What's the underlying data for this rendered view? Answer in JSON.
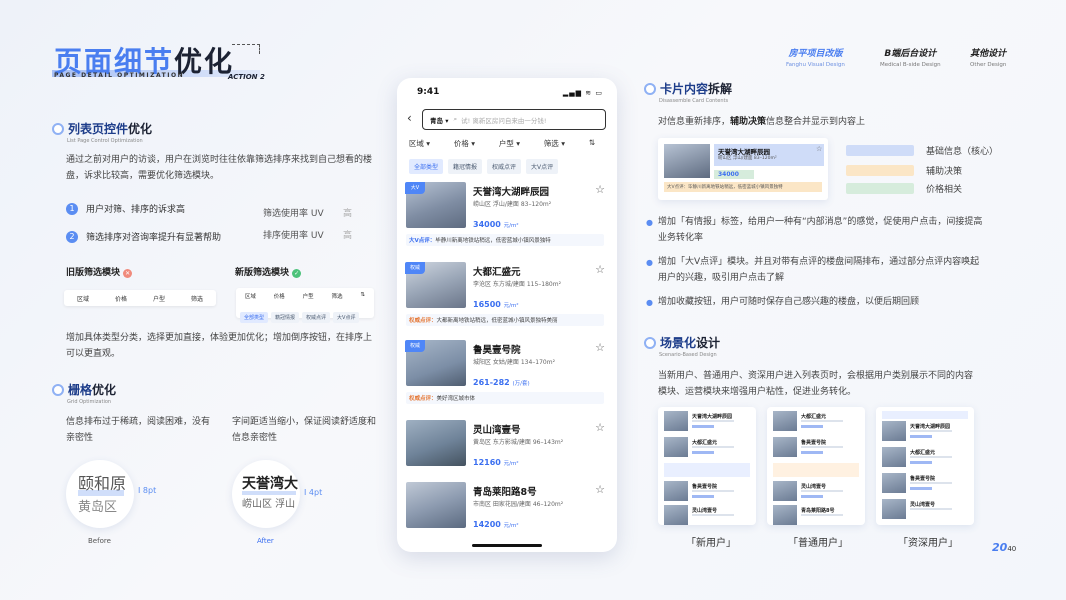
{
  "header": {
    "title_a": "页面细节",
    "title_b": "优化",
    "subtitle": "PAGE DETAIL OPTIMIZATION",
    "action": "ACTION 2",
    "nav": [
      {
        "cn": "房平项目改版",
        "en": "Fanghu Visual Design",
        "active": true
      },
      {
        "cn": "B端后台设计",
        "en": "Medical B-side Design",
        "active": false
      },
      {
        "cn": "其他设计",
        "en": "Other Design",
        "active": false
      }
    ]
  },
  "left": {
    "sec1": {
      "title_a": "列表页控件",
      "title_b": "优化",
      "sub": "List Page Control Optimization",
      "para": "通过之前对用户的访谈，用户在浏览时往往依靠筛选排序来找到自己想看的楼盘，诉求比较高，需要优化筛选模块。",
      "items": [
        {
          "n": "1",
          "text": "用户对筛、排序的诉求高",
          "metric": "筛选使用率 UV",
          "level": "高"
        },
        {
          "n": "2",
          "text": "筛选排序对咨询率提升有显著帮助",
          "metric": "排序使用率 UV",
          "level": "高"
        }
      ],
      "old_label": "旧版筛选模块",
      "new_label": "新版筛选模块",
      "filters": [
        "区域",
        "价格",
        "户型",
        "筛选"
      ],
      "chips": [
        "全部类型",
        "籍冠情报",
        "权威点评",
        "大V点评"
      ],
      "para2": "增加具体类型分类，选择更加直接，体验更加优化；增加倒序按钮，在排序上可以更直观。"
    },
    "sec2": {
      "title_a": "栅格",
      "title_b": "优化",
      "sub": "Grid Optimization",
      "before_text": "信息排布过于稀疏，阅读困难，没有亲密性",
      "after_text": "字间距适当缩小，保证阅读舒适度和信息亲密性",
      "before_name": "颐和原",
      "before_area": "黄岛区",
      "before_gap": "8pt",
      "before_label": "Before",
      "after_name": "天誉湾大",
      "after_area": "崂山区 浮山",
      "after_gap": "4pt",
      "after_label": "After"
    }
  },
  "phone": {
    "time": "9:41",
    "status": "▂▄▆ ≋ ▭",
    "city": "青岛 ▾",
    "placeholder": "试! 离新区房问自来由一分钱!",
    "back": "‹",
    "filters": [
      "区域 ▾",
      "价格 ▾",
      "户型 ▾",
      "筛选 ▾",
      "⇅"
    ],
    "chips": [
      "全部类型",
      "籍冠情报",
      "权威点评",
      "大V点评"
    ],
    "cards": [
      {
        "badge": "大V",
        "name": "天誉湾大湖畔辰园",
        "addr": "崂山区 浮山/建面 83–120m²",
        "price": "34000",
        "unit": "元/m²",
        "cmt_tag": "大V点评：",
        "cmt": "毕静川新离地铁站稍远，低密蓝城小镇风景独特",
        "cmt_type": "v"
      },
      {
        "badge": "权威",
        "name": "大都汇盛元",
        "addr": "李沧区 东方城/建面 115–180m²",
        "price": "16500",
        "unit": "元/m²",
        "cmt_tag": "权威点评：",
        "cmt": "大都新离地铁站稍远，低密蓝城小镇风景独特美丽",
        "cmt_type": "o"
      },
      {
        "badge": "权威",
        "name": "鲁昊壹号院",
        "addr": "城阳区 女姑/建面 134–170m²",
        "price": "261-282",
        "unit": "(万/套)",
        "cmt_tag": "权威点评：",
        "cmt": "美好湾区城市体",
        "cmt_type": "o"
      },
      {
        "badge": "",
        "name": "灵山湾壹号",
        "addr": "黄岛区 东方影城/建面 96–143m²",
        "price": "12160",
        "unit": "元/m²",
        "cmt_tag": "",
        "cmt": "",
        "cmt_type": ""
      },
      {
        "badge": "",
        "name": "青岛莱阳路8号",
        "addr": "市南区 田家花园/建面 46–120m²",
        "price": "14200",
        "unit": "元/m²",
        "cmt_tag": "",
        "cmt": "",
        "cmt_type": ""
      }
    ]
  },
  "right": {
    "sec3": {
      "title_a": "卡片内容",
      "title_b": "拆解",
      "sub": "Disassemble Card Contents",
      "intro_a": "对信息重新排序，",
      "intro_b": "辅助决策",
      "intro_c": "信息整合并显示到内容上",
      "legend": [
        {
          "text": "基础信息（核心）",
          "color": "#cfdcf8"
        },
        {
          "text": "辅助决策",
          "color": "#fbe6c6"
        },
        {
          "text": "价格相关",
          "color": "#d6ecdc"
        }
      ],
      "card_name": "天誉湾大湖畔辰园",
      "card_addr": "崂山区 浮山/建面 83–120m²",
      "card_price": "34000",
      "card_cmt": "大V点评：毕静川新离地铁站稍远，低密蓝城小镇风景独特",
      "bullets": [
        "增加「有情报」标签，给用户一种有“内部消息”的感觉，促使用户点击，间接提高业务转化率",
        "增加「大V点评」模块。并且对带有点评的楼盘间隔排布，通过部分点评内容唤起用户的兴趣，吸引用户点击了解",
        "增加收藏按钮，用户可随时保存自己感兴趣的楼盘，以便后期回顾"
      ]
    },
    "sec4": {
      "title_a": "场景化",
      "title_b": "设计",
      "sub": "Scenario-Based Design",
      "para": "当新用户、普通用户、资深用户进入列表页时，会根据用户类别展示不同的内容模块、运营模块来增强用户粘性，促进业务转化。",
      "labels": [
        "「新用户」",
        "「普通用户」",
        "「资深用户」"
      ]
    },
    "page": "20",
    "total": "40"
  }
}
